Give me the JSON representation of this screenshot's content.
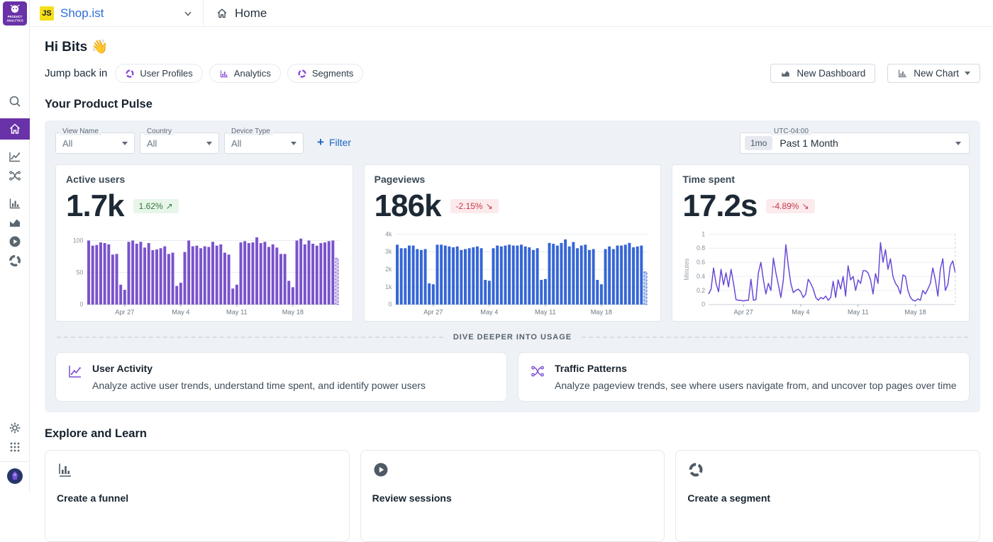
{
  "logo": {
    "line1": "PRODUCT",
    "line2": "ANALYTICS"
  },
  "header": {
    "project_badge": "JS",
    "project_name": "Shop.ist",
    "page_title": "Home"
  },
  "greeting": {
    "title": "Hi Bits",
    "emoji": "👋"
  },
  "jump": {
    "label": "Jump back in",
    "chips": [
      {
        "label": "User Profiles"
      },
      {
        "label": "Analytics"
      },
      {
        "label": "Segments"
      }
    ]
  },
  "actions": {
    "new_dashboard": "New Dashboard",
    "new_chart": "New Chart"
  },
  "pulse": {
    "title": "Your Product Pulse",
    "filters": [
      {
        "label": "View Name",
        "value": "All"
      },
      {
        "label": "Country",
        "value": "All"
      },
      {
        "label": "Device Type",
        "value": "All"
      }
    ],
    "add_filter": "Filter",
    "time_range": {
      "label": "UTC-04:00",
      "badge": "1mo",
      "value": "Past 1 Month"
    },
    "divider": "DIVE DEEPER INTO USAGE",
    "deep_dive": [
      {
        "title": "User Activity",
        "description": "Analyze active user trends, understand time spent, and identify power users"
      },
      {
        "title": "Traffic Patterns",
        "description": "Analyze pageview trends, see where users navigate from, and uncover top pages over time"
      }
    ]
  },
  "explore": {
    "title": "Explore and Learn",
    "cards": [
      {
        "title": "Create a funnel"
      },
      {
        "title": "Review sessions"
      },
      {
        "title": "Create a segment"
      }
    ]
  },
  "colors": {
    "accent_purple": "#6932a8",
    "bar_purple": "#7a52cc",
    "bar_blue": "#3566d6",
    "line_purple": "#6746d6",
    "delta_up": "#2f7d3f",
    "delta_down": "#c43a4b"
  },
  "chart_data": [
    {
      "id": "active-users",
      "type": "bar",
      "title": "Active users",
      "metric": "1.7k",
      "delta": "1.62%",
      "delta_direction": "up",
      "arrow": "↗",
      "color": "#7a52cc",
      "ylim": [
        0,
        110
      ],
      "grid": true,
      "y_ticks": [
        {
          "v": 0,
          "label": "0"
        },
        {
          "v": 50,
          "label": "50"
        },
        {
          "v": 100,
          "label": "100"
        }
      ],
      "x_tick_labels": [
        "Apr 27",
        "May 4",
        "May 11",
        "May 18"
      ],
      "x_tick_indices": [
        9,
        23,
        37,
        51
      ],
      "last_dashed": true,
      "values": [
        100,
        92,
        93,
        97,
        96,
        94,
        78,
        79,
        31,
        23,
        98,
        100,
        95,
        98,
        89,
        96,
        85,
        86,
        88,
        91,
        79,
        81,
        29,
        34,
        82,
        100,
        91,
        92,
        88,
        91,
        90,
        98,
        92,
        94,
        81,
        78,
        25,
        31,
        97,
        99,
        96,
        97,
        105,
        96,
        98,
        90,
        94,
        89,
        79,
        79,
        37,
        27,
        100,
        103,
        94,
        100,
        95,
        92,
        96,
        97,
        99,
        100,
        72
      ]
    },
    {
      "id": "pageviews",
      "type": "bar",
      "title": "Pageviews",
      "metric": "186k",
      "delta": "-2.15%",
      "delta_direction": "down",
      "arrow": "↘",
      "color": "#3566d6",
      "ylim": [
        0,
        4000
      ],
      "grid": true,
      "y_ticks": [
        {
          "v": 0,
          "label": "0"
        },
        {
          "v": 1000,
          "label": "1k"
        },
        {
          "v": 2000,
          "label": "2k"
        },
        {
          "v": 3000,
          "label": "3k"
        },
        {
          "v": 4000,
          "label": "4k"
        }
      ],
      "x_tick_labels": [
        "Apr 27",
        "May 4",
        "May 11",
        "May 18"
      ],
      "x_tick_indices": [
        9,
        23,
        37,
        51
      ],
      "last_dashed": true,
      "values": [
        3400,
        3200,
        3200,
        3350,
        3350,
        3150,
        3100,
        3150,
        1200,
        1150,
        3400,
        3400,
        3350,
        3300,
        3250,
        3300,
        3100,
        3150,
        3200,
        3250,
        3300,
        3200,
        1400,
        1350,
        3200,
        3350,
        3300,
        3350,
        3400,
        3350,
        3350,
        3400,
        3300,
        3250,
        3100,
        3200,
        1400,
        1450,
        3500,
        3450,
        3350,
        3500,
        3700,
        3300,
        3550,
        3200,
        3350,
        3400,
        3100,
        3150,
        1400,
        1150,
        3150,
        3300,
        3150,
        3350,
        3350,
        3400,
        3500,
        3250,
        3300,
        3350,
        1850
      ]
    },
    {
      "id": "time-spent",
      "type": "line",
      "title": "Time spent",
      "metric": "17.2s",
      "delta": "-4.89%",
      "delta_direction": "down",
      "arrow": "↘",
      "color": "#6746d6",
      "ylabel": "Minutes",
      "ylim": [
        0,
        1
      ],
      "grid": true,
      "right_dashed": true,
      "y_ticks": [
        {
          "v": 0,
          "label": "0"
        },
        {
          "v": 0.2,
          "label": "0.2"
        },
        {
          "v": 0.4,
          "label": "0.4"
        },
        {
          "v": 0.6,
          "label": "0.6"
        },
        {
          "v": 0.8,
          "label": "0.8"
        },
        {
          "v": 1,
          "label": "1"
        }
      ],
      "x_tick_labels": [
        "Apr 27",
        "May 4",
        "May 11",
        "May 18"
      ],
      "x_tick_indices": [
        14,
        37,
        60,
        83
      ],
      "values": [
        0.15,
        0.22,
        0.52,
        0.3,
        0.18,
        0.5,
        0.28,
        0.45,
        0.25,
        0.5,
        0.3,
        0.07,
        0.06,
        0.06,
        0.05,
        0.06,
        0.06,
        0.36,
        0.06,
        0.07,
        0.45,
        0.6,
        0.35,
        0.15,
        0.3,
        0.2,
        0.66,
        0.45,
        0.28,
        0.1,
        0.35,
        0.85,
        0.55,
        0.3,
        0.17,
        0.2,
        0.22,
        0.18,
        0.1,
        0.15,
        0.36,
        0.3,
        0.22,
        0.1,
        0.06,
        0.1,
        0.08,
        0.12,
        0.06,
        0.1,
        0.33,
        0.1,
        0.35,
        0.22,
        0.4,
        0.12,
        0.55,
        0.35,
        0.4,
        0.2,
        0.35,
        0.3,
        0.48,
        0.48,
        0.45,
        0.35,
        0.15,
        0.44,
        0.3,
        0.88,
        0.6,
        0.78,
        0.5,
        0.65,
        0.4,
        0.3,
        0.25,
        0.15,
        0.42,
        0.4,
        0.2,
        0.1,
        0.06,
        0.05,
        0.08,
        0.06,
        0.2,
        0.15,
        0.22,
        0.3,
        0.52,
        0.35,
        0.12,
        0.5,
        0.65,
        0.2,
        0.28,
        0.55,
        0.62,
        0.45
      ]
    }
  ]
}
